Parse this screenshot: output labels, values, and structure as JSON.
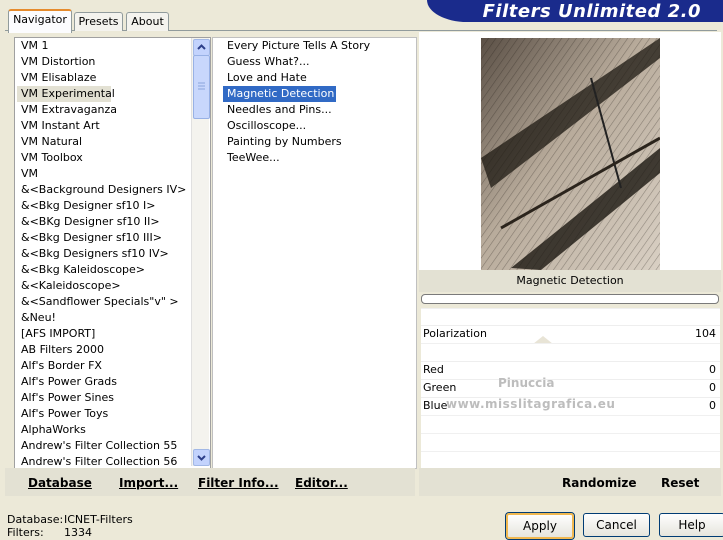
{
  "tabs": [
    {
      "label": "Navigator",
      "active": true
    },
    {
      "label": "Presets",
      "active": false
    },
    {
      "label": "About",
      "active": false
    }
  ],
  "banner": {
    "title": "Filters Unlimited 2.0",
    "color": "#1a2b8c"
  },
  "categories": [
    "VM 1",
    "VM Distortion",
    "VM Elisablaze",
    "VM Experimental",
    "VM Extravaganza",
    "VM Instant Art",
    "VM Natural",
    "VM Toolbox",
    "VM",
    "&<Background Designers IV>",
    "&<Bkg Designer sf10 I>",
    "&<BKg Designer sf10 II>",
    "&<Bkg Designer sf10 III>",
    "&<Bkg Designers sf10 IV>",
    "&<Bkg Kaleidoscope>",
    "&<Kaleidoscope>",
    "&<Sandflower Specials\"v\" >",
    "&Neu!",
    "[AFS IMPORT]",
    "AB Filters 2000",
    "Alf's Border FX",
    "Alf's Power Grads",
    "Alf's Power Sines",
    "Alf's Power Toys",
    "AlphaWorks",
    "Andrew's Filter Collection 55",
    "Andrew's Filter Collection 56"
  ],
  "selected_category": 3,
  "filters": [
    "Every Picture Tells A Story",
    "Guess  What?...",
    "Love and Hate",
    "Magnetic Detection",
    "Needles and Pins...",
    "Oscilloscope...",
    "Painting by Numbers",
    "TeeWee..."
  ],
  "selected_filter": 3,
  "preview": {
    "filter_name": "Magnetic Detection"
  },
  "params": [
    {
      "label": "Polarization",
      "value": "104"
    },
    {
      "label": "Red",
      "value": "0"
    },
    {
      "label": "Green",
      "value": "0"
    },
    {
      "label": "Blue",
      "value": "0"
    }
  ],
  "watermark": {
    "line1": "Pinuccia",
    "line2": "www.misslitagrafica.eu"
  },
  "left_buttons": {
    "database": "Database",
    "import": "Import...",
    "filter_info": "Filter Info...",
    "editor": "Editor..."
  },
  "right_buttons": {
    "randomize": "Randomize",
    "reset": "Reset"
  },
  "status": {
    "database_label": "Database:",
    "database_value": "ICNET-Filters",
    "filters_label": "Filters:",
    "filters_value": "1334"
  },
  "dialog_buttons": {
    "apply": "Apply",
    "cancel": "Cancel",
    "help": "Help"
  },
  "colors": {
    "selection_blue": "#316ac5",
    "selection_gray": "#e3e1d3",
    "tab_accent": "#e68b2c"
  }
}
